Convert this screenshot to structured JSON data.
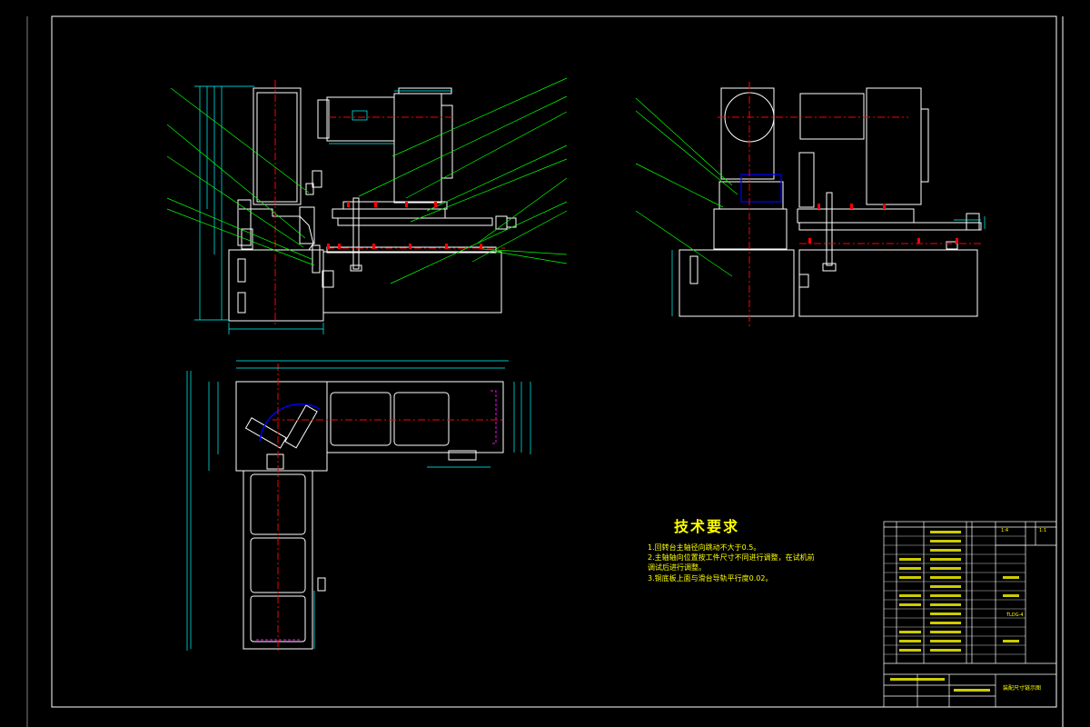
{
  "technical_requirements": {
    "title": "技术要求",
    "lines": [
      "1.回转台主轴径向跳动不大于0.5。",
      "2.主轴轴向位置按工件尺寸不同进行调整，在试机前",
      "   调试后进行调整。",
      "3.铜底板上面与滑台导轨平行度0.02。"
    ]
  },
  "title_block": {
    "drawing_title": "装配尺寸链示图",
    "drawing_no": "TLDG-4",
    "scale_note": "1:4",
    "material_note": "1:1"
  },
  "colors": {
    "frame": "#ffffff",
    "outline": "#ffffff",
    "dimension": "#00ffff",
    "leader": "#00ff00",
    "centerline": "#ff0000",
    "text": "#ffff00",
    "hidden": "#ff00ff",
    "blue": "#0000ff"
  }
}
